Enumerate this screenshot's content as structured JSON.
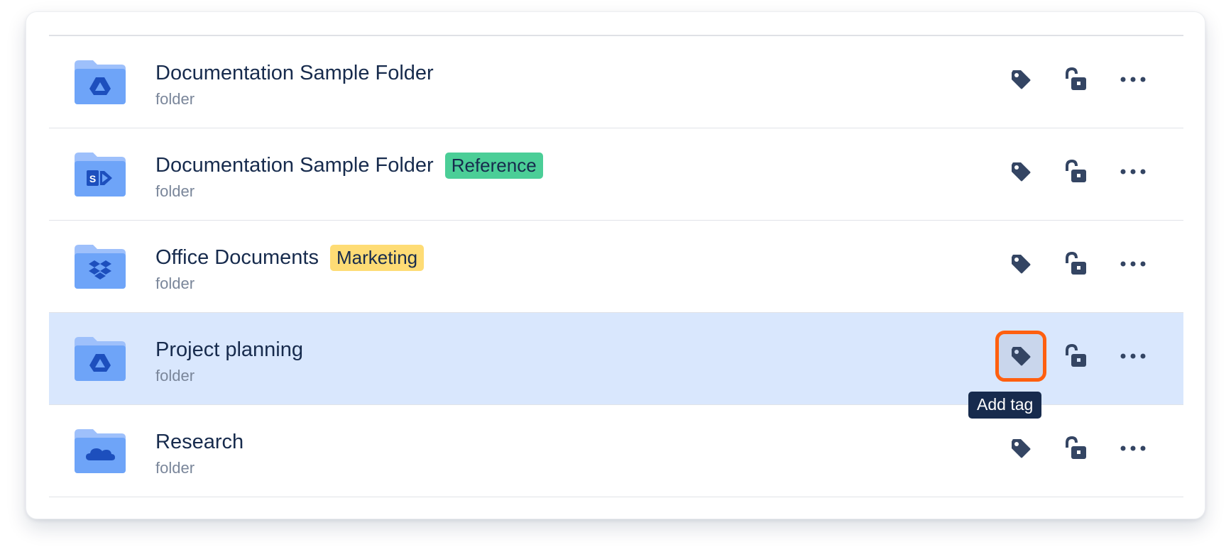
{
  "colors": {
    "selected_row": "#d9e7fd",
    "focus_ring": "#ff5f0f",
    "icon": "#344563",
    "folder_back": "#9ec0fb",
    "folder_front": "#6ea4f8",
    "folder_glyph": "#1d4fbd"
  },
  "items": [
    {
      "title": "Documentation Sample Folder",
      "subtitle": "folder",
      "badge": "",
      "badge_color": "",
      "source_icon": "google-drive-icon"
    },
    {
      "title": "Documentation Sample Folder",
      "subtitle": "folder",
      "badge": "Reference",
      "badge_color": "#4bce97",
      "source_icon": "sharepoint-icon"
    },
    {
      "title": "Office Documents",
      "subtitle": "folder",
      "badge": "Marketing",
      "badge_color": "#fedc75",
      "source_icon": "dropbox-icon"
    },
    {
      "title": "Project planning",
      "subtitle": "folder",
      "badge": "",
      "badge_color": "",
      "source_icon": "google-drive-icon",
      "selected": true
    },
    {
      "title": "Research",
      "subtitle": "folder",
      "badge": "",
      "badge_color": "",
      "source_icon": "onedrive-icon"
    }
  ],
  "actions": {
    "tag_icon": "tag-icon",
    "lock_icon": "unlock-icon",
    "more_icon": "more-horizontal-icon"
  },
  "tooltip": {
    "text": "Add tag"
  }
}
